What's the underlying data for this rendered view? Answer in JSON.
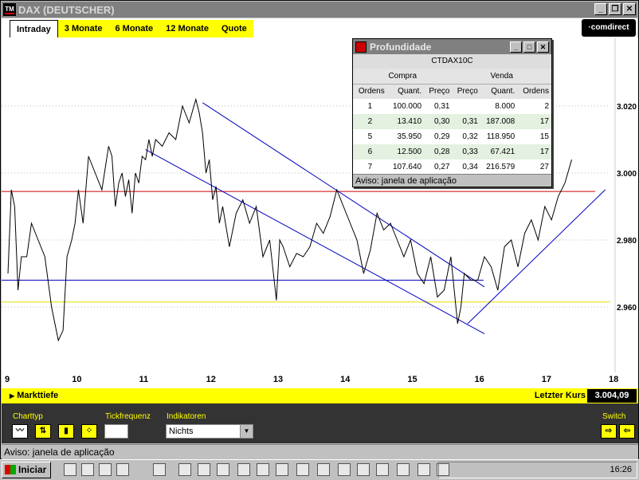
{
  "window": {
    "title": "DAX (DEUTSCHER)",
    "app_logo": "TM",
    "buttons": [
      "minimize-icon",
      "restore-icon",
      "close-icon"
    ]
  },
  "tabs": [
    "Intraday",
    "3 Monate",
    "6 Monate",
    "12 Monate",
    "Quote"
  ],
  "active_tab": "Intraday",
  "brand": "comdirect",
  "chart_data": {
    "type": "line",
    "x_tick_labels": [
      "9",
      "10",
      "11",
      "12",
      "13",
      "14",
      "15",
      "16",
      "17",
      "18"
    ],
    "y_tick_labels": [
      "3.020",
      "3.000",
      "2.980",
      "2.960"
    ],
    "ylim": [
      2.945,
      3.032
    ],
    "xlim": [
      9,
      18
    ],
    "grid": "horizontal dotted",
    "series": [
      {
        "x": [
          9.0,
          9.05,
          9.1,
          9.15,
          9.2,
          9.28,
          9.35,
          9.45,
          9.55,
          9.65,
          9.75,
          9.82,
          9.88,
          9.95,
          10.0,
          10.05,
          10.12,
          10.2,
          10.3,
          10.4,
          10.5,
          10.55,
          10.6,
          10.65,
          10.7,
          10.75,
          10.8,
          10.85,
          10.9,
          10.95,
          11.0,
          11.05,
          11.1,
          11.15,
          11.2,
          11.3,
          11.4,
          11.5,
          11.6,
          11.7,
          11.8,
          11.85,
          11.9,
          11.95,
          12.0,
          12.05,
          12.1,
          12.15,
          12.2,
          12.3,
          12.4,
          12.5,
          12.6,
          12.7,
          12.8,
          12.9,
          13.0,
          13.05,
          13.1,
          13.2,
          13.3,
          13.4,
          13.5,
          13.6,
          13.7,
          13.8,
          13.9,
          14.0,
          14.1,
          14.2,
          14.3,
          14.4,
          14.5,
          14.6,
          14.7,
          14.8,
          14.9,
          15.0,
          15.1,
          15.2,
          15.3,
          15.4,
          15.5,
          15.6,
          15.7,
          15.75,
          15.8,
          15.9,
          16.0,
          16.1,
          16.2,
          16.3,
          16.4,
          16.5,
          16.6,
          16.7,
          16.8,
          16.9,
          17.0,
          17.1,
          17.2,
          17.3,
          17.4
        ],
        "y": [
          2.97,
          2.995,
          2.99,
          2.965,
          2.975,
          2.975,
          2.985,
          2.98,
          2.975,
          2.96,
          2.95,
          2.953,
          2.975,
          2.98,
          2.985,
          2.995,
          2.985,
          3.005,
          3.0,
          2.995,
          3.008,
          3.005,
          2.99,
          2.997,
          3.0,
          2.993,
          2.998,
          2.988,
          3.0,
          2.997,
          3.005,
          3.004,
          3.01,
          3.005,
          3.01,
          3.008,
          3.012,
          3.01,
          3.02,
          3.015,
          3.022,
          3.018,
          3.012,
          3.0,
          3.004,
          2.992,
          2.996,
          2.985,
          2.99,
          2.978,
          2.988,
          2.992,
          2.985,
          2.99,
          2.975,
          2.98,
          2.962,
          2.98,
          2.978,
          2.972,
          2.976,
          2.975,
          2.978,
          2.985,
          2.982,
          2.987,
          2.995,
          2.99,
          2.985,
          2.98,
          2.97,
          2.977,
          2.988,
          2.983,
          2.985,
          2.98,
          2.975,
          2.98,
          2.97,
          2.967,
          2.975,
          2.963,
          2.965,
          2.975,
          2.955,
          2.96,
          2.97,
          2.968,
          2.968,
          2.975,
          2.972,
          2.965,
          2.978,
          2.98,
          2.972,
          2.982,
          2.986,
          2.98,
          2.99,
          2.986,
          2.993,
          2.997,
          3.004
        ]
      }
    ]
  },
  "profundidade": {
    "title": "Profundidade",
    "symbol": "CTDAX10C",
    "groups": [
      "Compra",
      "Venda"
    ],
    "columns": [
      "Ordens",
      "Quant.",
      "Preço",
      "Preço",
      "Quant.",
      "Ordens"
    ],
    "rows": [
      [
        "1",
        "100.000",
        "0,31",
        "",
        "8.000",
        "2"
      ],
      [
        "2",
        "13.410",
        "0,30",
        "0,31",
        "187.008",
        "17"
      ],
      [
        "5",
        "35.950",
        "0,29",
        "0,32",
        "118.950",
        "15"
      ],
      [
        "6",
        "12.500",
        "0,28",
        "0,33",
        "67.421",
        "17"
      ],
      [
        "7",
        "107.640",
        "0,27",
        "0,34",
        "216.579",
        "27"
      ]
    ],
    "aviso": "Aviso: janela de aplicação"
  },
  "infobar": {
    "left": "Markttiefe",
    "right_label": "Letzter Kurs",
    "right_value": "3.004,09"
  },
  "controls": {
    "charttyp": "Charttyp",
    "tickfrequenz": "Tickfrequenz",
    "indikatoren": "Indikatoren",
    "indikator_value": "Nichts",
    "switch": "Switch"
  },
  "status": "Aviso: janela de aplicação",
  "taskbar": {
    "start": "Iniciar",
    "clock": "16:26"
  }
}
